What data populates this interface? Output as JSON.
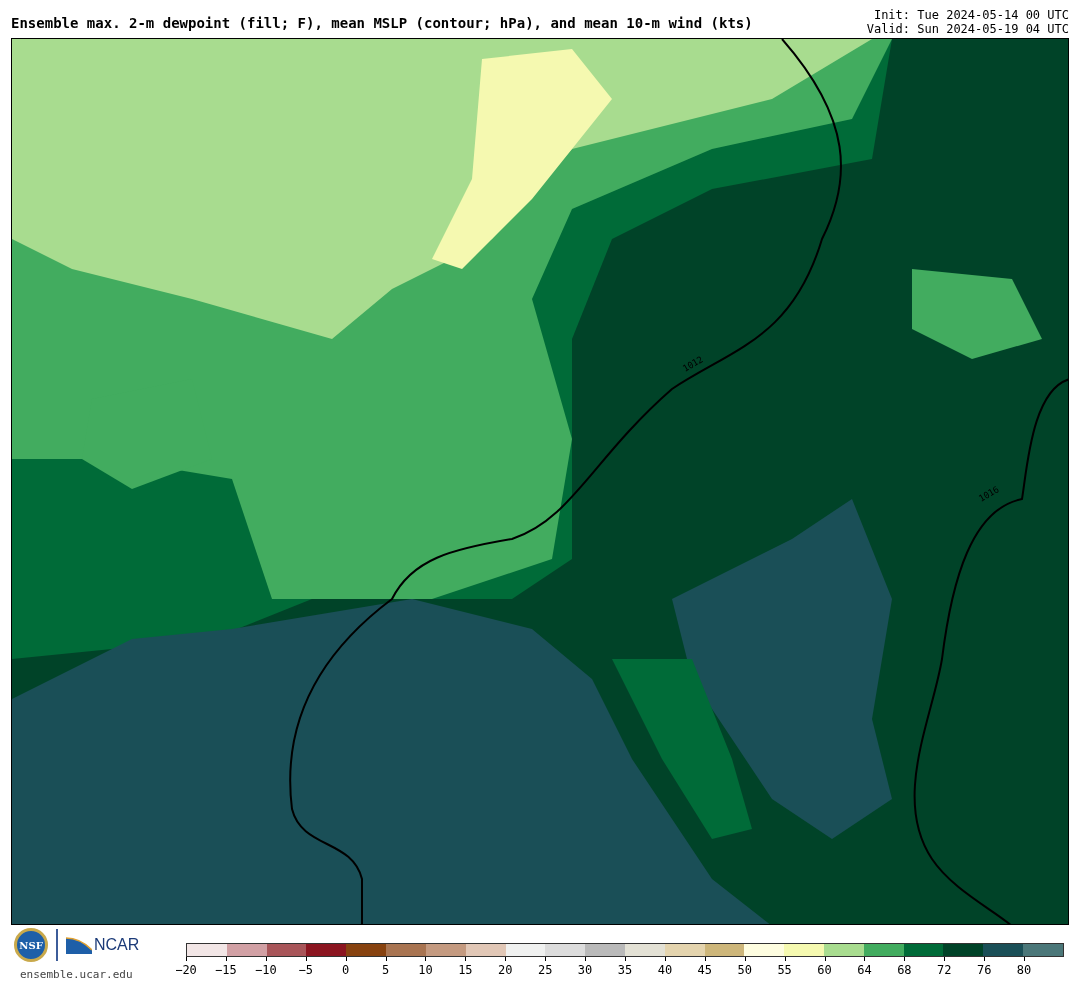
{
  "title": "Ensemble max. 2-m dewpoint (fill; F), mean MSLP (contour; hPa), and mean 10-m wind (kts)",
  "init": "Init: Tue 2024-05-14 00 UTC",
  "valid": "Valid: Sun 2024-05-19 04 UTC",
  "map": {
    "contour_labels": [
      "1012",
      "1016"
    ]
  },
  "logo": {
    "nsf": "NSF",
    "ncar": "NCAR",
    "url": "ensemble.ucar.edu"
  },
  "colorbar": {
    "segments": [
      {
        "color": "#f2e6e6"
      },
      {
        "color": "#d1a0a4"
      },
      {
        "color": "#a85559"
      },
      {
        "color": "#8b1520"
      },
      {
        "color": "#87420f"
      },
      {
        "color": "#a87451"
      },
      {
        "color": "#c49a80"
      },
      {
        "color": "#e1c7b6"
      },
      {
        "color": "#f0f1f0"
      },
      {
        "color": "#dcdcdc"
      },
      {
        "color": "#b9b9b9"
      },
      {
        "color": "#e3e1d5"
      },
      {
        "color": "#e4d4ae"
      },
      {
        "color": "#cdb67a"
      },
      {
        "color": "#fefde0"
      },
      {
        "color": "#f5f9b0"
      },
      {
        "color": "#a8dc8f"
      },
      {
        "color": "#42ac5f"
      },
      {
        "color": "#006b38"
      },
      {
        "color": "#004328"
      },
      {
        "color": "#1a4f57"
      },
      {
        "color": "#4b7779"
      }
    ],
    "ticks": [
      "−20",
      "−15",
      "−10",
      "−5",
      "0",
      "5",
      "10",
      "15",
      "20",
      "25",
      "30",
      "35",
      "40",
      "45",
      "50",
      "55",
      "60",
      "64",
      "68",
      "72",
      "76",
      "80"
    ]
  }
}
